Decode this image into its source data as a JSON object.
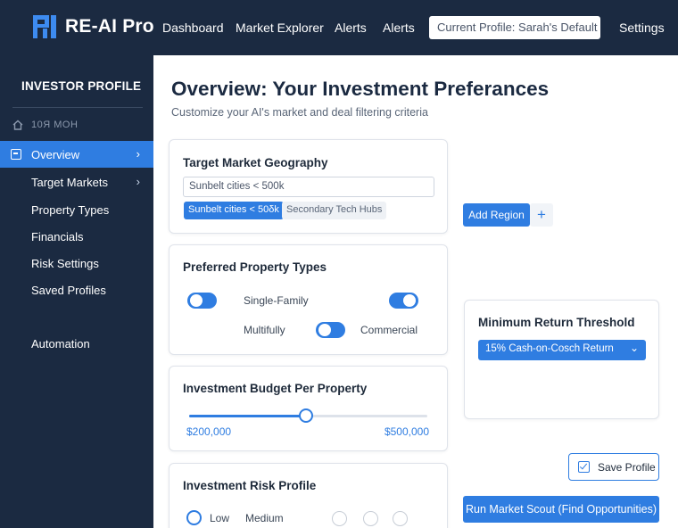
{
  "header": {
    "app_name": "RE-AI Pro",
    "nav": [
      "Dashboard",
      "Market Explorer",
      "Alerts",
      "Alerts"
    ],
    "profile_field": "Current Profile: Sarah's Default",
    "settings": "Settings"
  },
  "sidebar": {
    "title": "INVESTOR PROFILE",
    "home_label": "10Я MOH",
    "items": [
      {
        "label": "Overview",
        "active": true,
        "chevron": true
      },
      {
        "label": "Target Markets",
        "active": false,
        "chevron": true
      },
      {
        "label": "Property Types",
        "active": false,
        "chevron": false
      },
      {
        "label": "Financials",
        "active": false,
        "chevron": false
      },
      {
        "label": "Risk Settings",
        "active": false,
        "chevron": false
      },
      {
        "label": "Saved Profiles",
        "active": false,
        "chevron": false
      },
      {
        "label": "Automation",
        "active": false,
        "chevron": false
      }
    ]
  },
  "main": {
    "title": "Overview: Your Investment Preferances",
    "subtitle": "Customize your AI's market and deal filtering criteria",
    "geography": {
      "title": "Target Market Geography",
      "input_value": "Sunbelt cities < 500k",
      "chips": [
        "Sunbelt cities < 50δk",
        "Secondary Tech Hubs"
      ],
      "add_region_label": "Add Region",
      "add_icon": "+"
    },
    "property_types": {
      "title": "Preferred Property Types",
      "options": [
        {
          "label": "Single-Family",
          "on": true
        },
        {
          "label": "Multifully",
          "on": true
        },
        {
          "label": "Commercial",
          "on": true
        }
      ]
    },
    "budget": {
      "title": "Investment Budget Per Property",
      "min_label": "$200,000",
      "max_label": "$500,000",
      "fill_fraction": 0.49
    },
    "risk": {
      "title": "Investment Risk Profile",
      "low_label": "Low",
      "medium_label": "Medium"
    },
    "return_threshold": {
      "title": "Minimum Return Threshold",
      "selected": "15% Cash-on-Cosch Return"
    },
    "save_label": "Save Profile",
    "run_label": "Run Market Scout (Find Opportunities)"
  },
  "colors": {
    "navy": "#1b2a41",
    "accent": "#2f7de1"
  }
}
